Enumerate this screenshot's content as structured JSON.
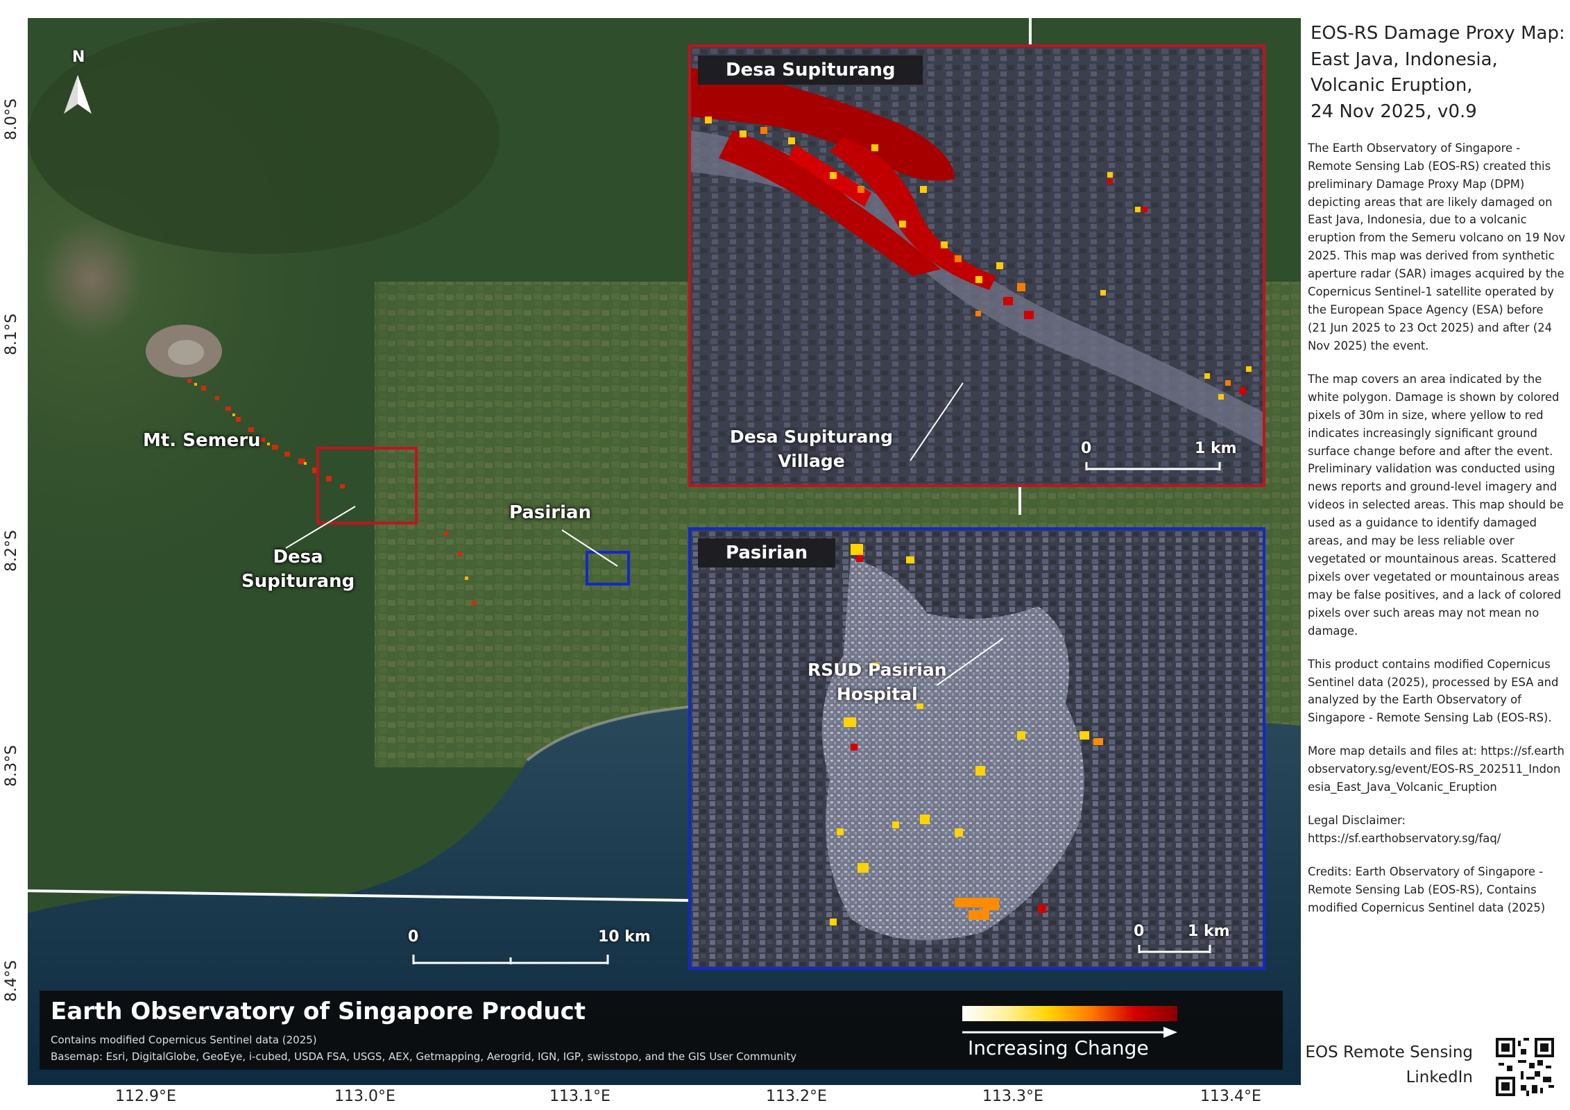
{
  "map": {
    "north_label": "N",
    "lat_ticks": [
      "8.0°S",
      "8.1°S",
      "8.2°S",
      "8.3°S",
      "8.4°S"
    ],
    "lon_ticks": [
      "112.9°E",
      "113.0°E",
      "113.1°E",
      "113.2°E",
      "113.3°E",
      "113.4°E"
    ],
    "places": {
      "semeru": "Mt. Semeru",
      "desa_line1": "Desa",
      "desa_line2": "Supiturang",
      "pasirian": "Pasirian"
    },
    "scalebar": {
      "start": "0",
      "end": "10 km"
    }
  },
  "insets": [
    {
      "title": "Desa Supiturang",
      "border_color": "#c0141e",
      "label_line1": "Desa Supiturang",
      "label_line2": "Village",
      "scale_start": "0",
      "scale_end": "1 km"
    },
    {
      "title": "Pasirian",
      "border_color": "#1428c8",
      "label_line1": "RSUD Pasirian",
      "label_line2": "Hospital",
      "scale_start": "0",
      "scale_end": "1 km"
    }
  ],
  "banner": {
    "title": "Earth Observatory of Singapore Product",
    "line1": "Contains modified Copernicus Sentinel data (2025)",
    "line2": "Basemap: Esri, DigitalGlobe, GeoEye, i-cubed, USDA FSA, USGS, AEX, Getmapping, Aerogrid, IGN, IGP, swisstopo, and the GIS User Community"
  },
  "legend": {
    "label": "Increasing Change",
    "colors": [
      "#ffffff",
      "#ffd400",
      "#ff7a00",
      "#d40000",
      "#8a0000"
    ]
  },
  "sidebar": {
    "title_lines": [
      "EOS-RS Damage Proxy Map:",
      "East Java, Indonesia,",
      "Volcanic Eruption,",
      "24 Nov 2025, v0.9"
    ],
    "para1": "The Earth Observatory of Singapore - Remote Sensing Lab (EOS-RS) created this preliminary Damage Proxy Map (DPM) depicting areas that are likely damaged on East Java, Indonesia, due to a volcanic eruption from the Semeru volcano on 19 Nov 2025. This map was derived from synthetic aperture radar (SAR) images acquired by the Copernicus Sentinel-1 satellite operated by the European Space Agency (ESA) before (21 Jun 2025 to 23 Oct 2025) and after (24 Nov 2025) the event.",
    "para2": "The map covers an area indicated by the white polygon. Damage is shown by colored pixels of 30m in size, where yellow to red indicates increasingly significant ground surface change before and after the event. Preliminary validation was conducted using news reports and ground-level imagery and videos in selected areas. This map should be used as a guidance to identify damaged areas, and may be less reliable over vegetated or mountainous areas. Scattered pixels over vegetated or mountainous areas may be false positives, and a lack of colored pixels over such areas may not mean no damage.",
    "para3": "This product contains modified Copernicus Sentinel data (2025), processed by ESA and analyzed by the Earth Observatory of Singapore - Remote Sensing Lab (EOS-RS).",
    "para4": "More map details and files at: https://sf.earthobservatory.sg/event/EOS-RS_202511_Indonesia_East_Java_Volcanic_Eruption",
    "para5": "Legal Disclaimer: https://sf.earthobservatory.sg/faq/",
    "para6": "Credits: Earth Observatory of Singapore - Remote Sensing Lab (EOS-RS), Contains modified Copernicus Sentinel data (2025)",
    "brand_line1": "EOS Remote Sensing",
    "brand_line2": "LinkedIn"
  }
}
